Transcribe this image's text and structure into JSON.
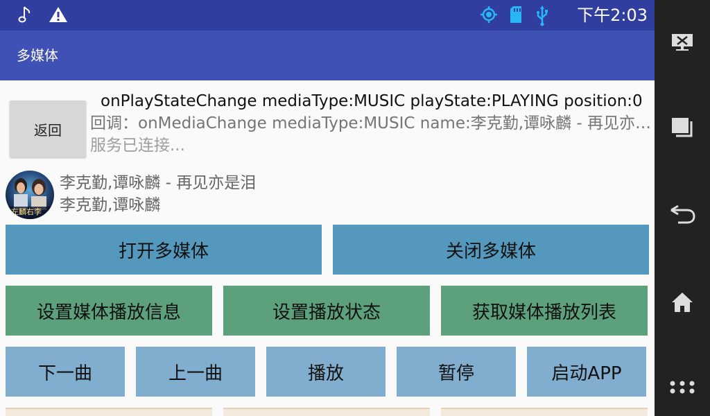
{
  "status_bar": {
    "time": "下午2:03",
    "left_icons": [
      "music-note-icon",
      "warning-icon"
    ],
    "right_icons": [
      "gps-icon",
      "sd-card-icon",
      "usb-icon"
    ]
  },
  "app_bar": {
    "title": "多媒体"
  },
  "back_button": {
    "label": "返回"
  },
  "log": {
    "line1": "onPlayStateChange mediaType:MUSIC playState:PLAYING position:0",
    "line2": "回调：onMediaChange mediaType:MUSIC name:李克勤,谭咏麟 - 再见亦是泪",
    "line3": "服务已连接..."
  },
  "now_playing": {
    "title": "李克勤,谭咏麟 - 再见亦是泪",
    "artist": "李克勤,谭咏麟"
  },
  "buttons": {
    "open_media": "打开多媒体",
    "close_media": "关闭多媒体",
    "set_media_info": "设置媒体播放信息",
    "set_play_state": "设置播放状态",
    "get_playlist": "获取媒体播放列表",
    "next": "下一曲",
    "previous": "上一曲",
    "play": "播放",
    "pause": "暂停",
    "launch_app": "启动APP"
  },
  "colors": {
    "status_bar": "#303f9f",
    "app_bar": "#3f51b5",
    "nav_bar": "#222222",
    "button_blue": "#5499bd",
    "button_green": "#5da07c",
    "button_light_blue": "#81adcf",
    "status_icon_accent": "#29b6f6"
  }
}
